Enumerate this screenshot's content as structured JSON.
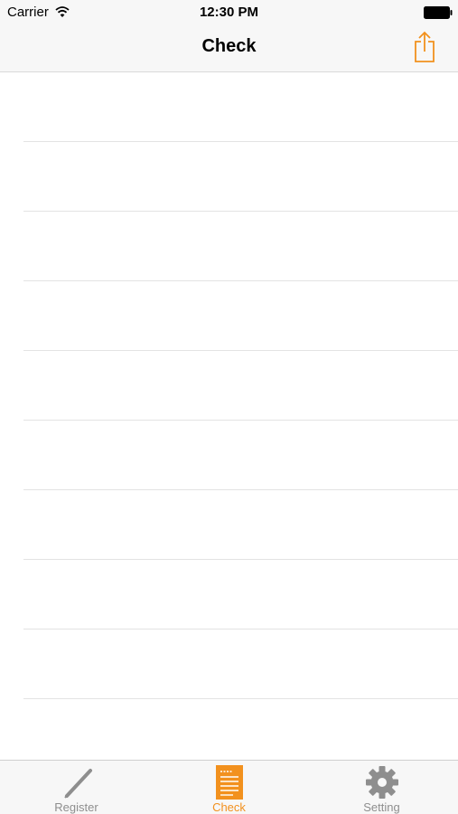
{
  "status_bar": {
    "carrier": "Carrier",
    "time": "12:30 PM",
    "wifi_icon": "wifi-icon",
    "battery_icon": "battery-icon"
  },
  "nav": {
    "title": "Check",
    "share_icon": "share-icon"
  },
  "table": {
    "rows": [
      "",
      "",
      "",
      "",
      "",
      "",
      "",
      "",
      "",
      ""
    ]
  },
  "tabbar": {
    "tabs": [
      {
        "label": "Register",
        "icon": "pencil-icon",
        "active": false
      },
      {
        "label": "Check",
        "icon": "document-icon",
        "active": true
      },
      {
        "label": "Setting",
        "icon": "gear-icon",
        "active": false
      }
    ]
  },
  "colors": {
    "accent": "#f2911e",
    "inactive": "#8e8e8e",
    "bar_background": "#f7f7f7",
    "separator": "#e3e3e3"
  }
}
